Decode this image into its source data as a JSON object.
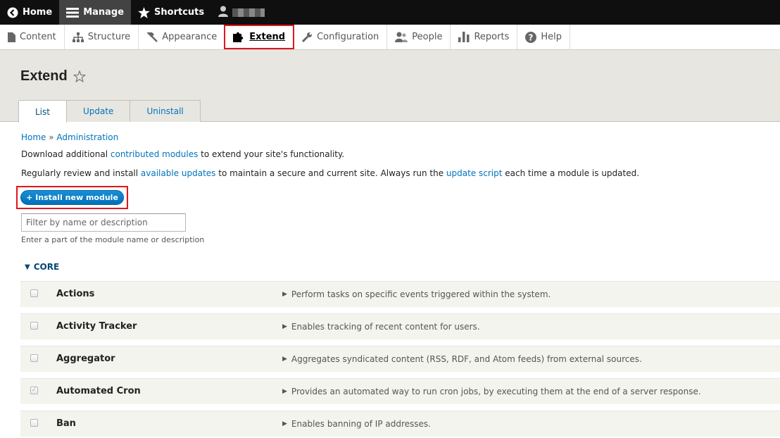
{
  "toolbar": {
    "home": "Home",
    "manage": "Manage",
    "shortcuts": "Shortcuts"
  },
  "tray": {
    "items": [
      {
        "label": "Content",
        "icon": "file-icon"
      },
      {
        "label": "Structure",
        "icon": "sitemap-icon"
      },
      {
        "label": "Appearance",
        "icon": "paint-icon"
      },
      {
        "label": "Extend",
        "icon": "puzzle-icon"
      },
      {
        "label": "Configuration",
        "icon": "wrench-icon"
      },
      {
        "label": "People",
        "icon": "people-icon"
      },
      {
        "label": "Reports",
        "icon": "bar-chart-icon"
      },
      {
        "label": "Help",
        "icon": "help-icon"
      }
    ],
    "active": "Extend"
  },
  "header": {
    "title": "Extend",
    "tabs": [
      "List",
      "Update",
      "Uninstall"
    ]
  },
  "breadcrumb": {
    "home": "Home",
    "sep": " » ",
    "admin": "Administration"
  },
  "intro": {
    "p1_before": "Download additional ",
    "p1_link": "contributed modules",
    "p1_after": " to extend your site's functionality.",
    "p2_before": "Regularly review and install ",
    "p2_link1": "available updates",
    "p2_mid": " to maintain a secure and current site. Always run the ",
    "p2_link2": "update script",
    "p2_after": " each time a module is updated."
  },
  "install_button": "+ Install new module",
  "filter": {
    "placeholder": "Filter by name or description",
    "description": "Enter a part of the module name or description"
  },
  "section": {
    "label": "CORE"
  },
  "modules": [
    {
      "name": "Actions",
      "description": "Perform tasks on specific events triggered within the system.",
      "checked": false
    },
    {
      "name": "Activity Tracker",
      "description": "Enables tracking of recent content for users.",
      "checked": false
    },
    {
      "name": "Aggregator",
      "description": "Aggregates syndicated content (RSS, RDF, and Atom feeds) from external sources.",
      "checked": false
    },
    {
      "name": "Automated Cron",
      "description": "Provides an automated way to run cron jobs, by executing them at the end of a server response.",
      "checked": true
    },
    {
      "name": "Ban",
      "description": "Enables banning of IP addresses.",
      "checked": false
    }
  ],
  "colors": {
    "link": "#0074bd",
    "highlight": "#e0161c",
    "button": "#0071b8"
  }
}
